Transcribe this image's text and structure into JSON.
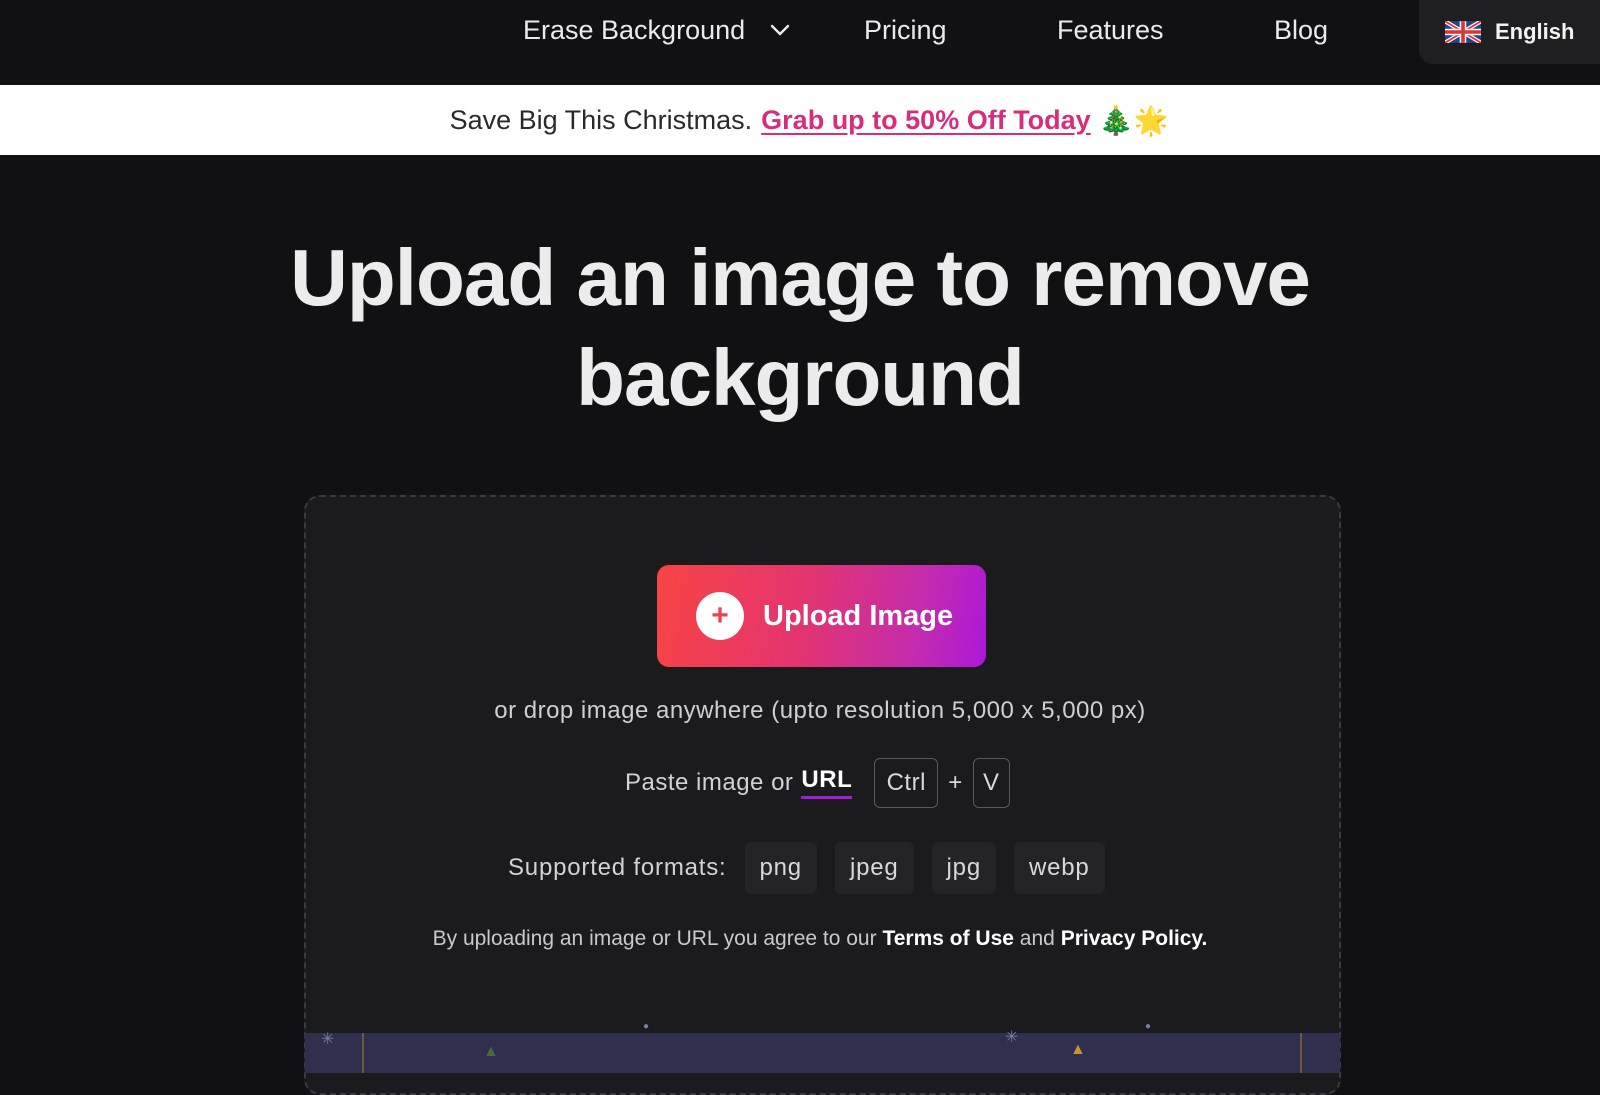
{
  "nav": {
    "items": [
      {
        "label": "Erase Background",
        "has_dropdown": true
      },
      {
        "label": "Pricing"
      },
      {
        "label": "Features"
      },
      {
        "label": "Blog"
      }
    ],
    "language": {
      "label": "English",
      "flag_icon": "uk-flag-icon"
    }
  },
  "promo": {
    "text": "Save Big This Christmas.",
    "link": "Grab up to 50% Off Today",
    "emoji": "🎄🌟"
  },
  "hero": {
    "title_line1": "Upload an image to remove",
    "title_line2": "background"
  },
  "upload": {
    "button_label": "Upload Image",
    "button_icon": "plus-icon",
    "drop_text": "or drop image anywhere (upto resolution 5,000 x 5,000 px)",
    "paste_text": "Paste image or",
    "url_label": "URL",
    "shortcut": {
      "key1": "Ctrl",
      "plus": "+",
      "key2": "V"
    },
    "formats_label": "Supported formats:",
    "formats": [
      "png",
      "jpeg",
      "jpg",
      "webp"
    ],
    "terms": {
      "prefix": "By uploading an image or URL you agree to our",
      "terms_link": "Terms of Use",
      "and": "and",
      "privacy_link": "Privacy Policy."
    }
  },
  "colors": {
    "accent_pink": "#d62d7c",
    "gradient_start": "#f84444",
    "gradient_end": "#ab18d8",
    "background": "#111114"
  }
}
